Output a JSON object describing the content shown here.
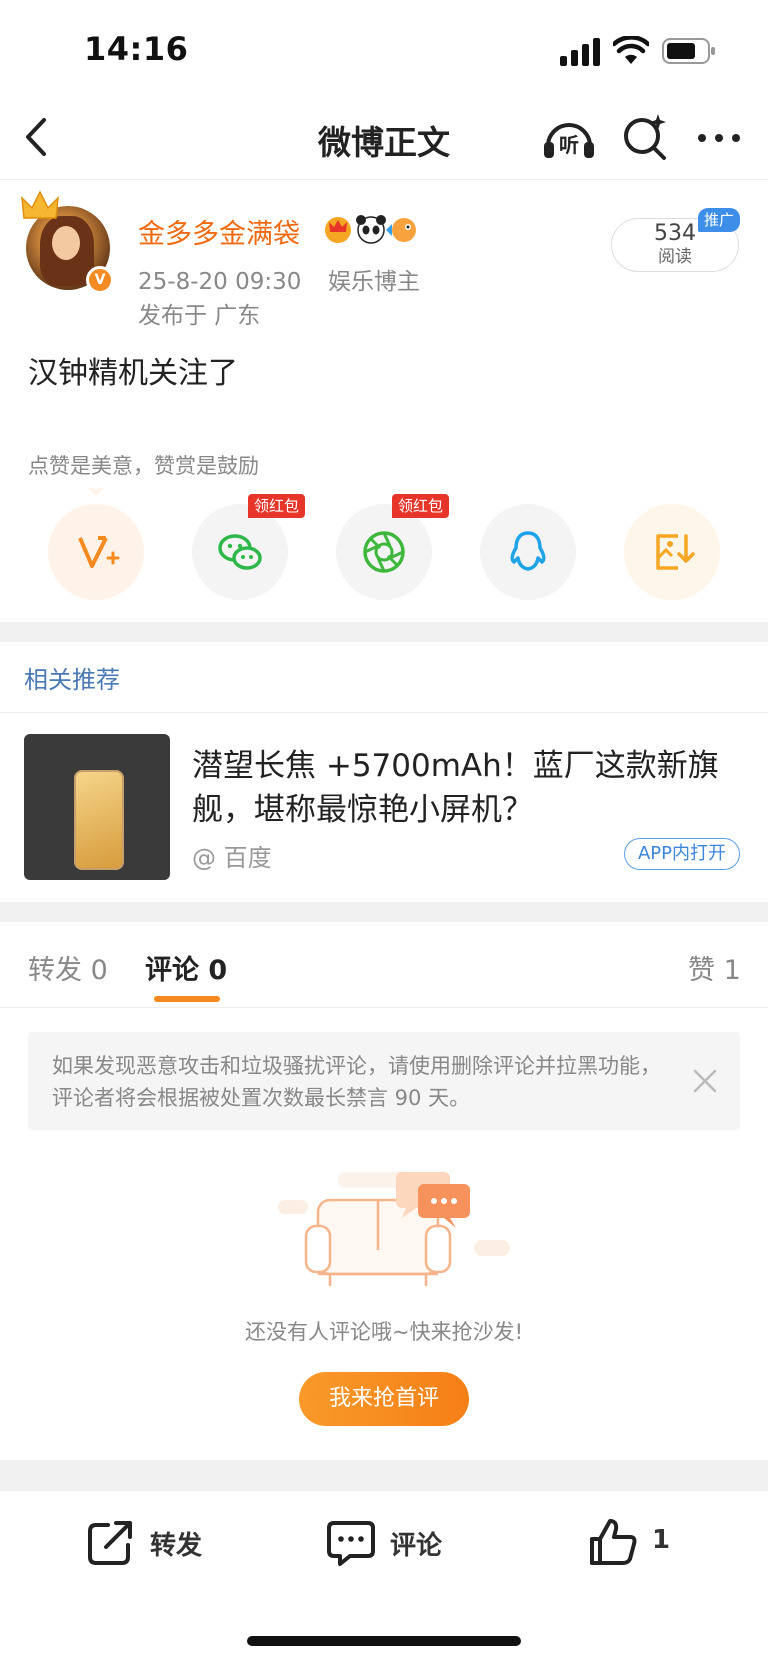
{
  "status_bar": {
    "time": "14:16"
  },
  "nav": {
    "title": "微博正文",
    "listen_icon": "headphones-listen-icon",
    "listen_label": "听",
    "search_icon": "search-sparkle-icon",
    "more_icon": "more-dots-icon"
  },
  "post": {
    "username": "金多多金满袋",
    "username_color": "#f26a10",
    "date_time": "25-8-20 09:30",
    "user_tag": "娱乐博主",
    "location": "发布于 广东",
    "reads_count": "534",
    "reads_label": "阅读",
    "promo_label": "推广",
    "content": "汉钟精机关注了",
    "verified_mark": "V"
  },
  "reward": {
    "tip": "点赞是美意，赞赏是鼓励",
    "share_buttons": [
      {
        "icon": "reward-v-icon"
      },
      {
        "icon": "wechat-icon",
        "badge": "领红包"
      },
      {
        "icon": "moments-icon",
        "badge": "领红包"
      },
      {
        "icon": "qq-icon"
      },
      {
        "icon": "save-image-icon"
      }
    ]
  },
  "related": {
    "section_title": "相关推荐",
    "headline": "潜望长焦 +5700mAh！蓝厂这款新旗舰，堪称最惊艳小屏机？",
    "source": "@ 百度",
    "open_in_app": "APP内打开"
  },
  "tabs": {
    "forward": "转发 0",
    "comments": "评论 0",
    "likes": "赞 1"
  },
  "notice": {
    "text": "如果发现恶意攻击和垃圾骚扰评论，请使用删除评论并拉黑功能，评论者将会根据被处置次数最长禁言 90 天。"
  },
  "empty_state": {
    "text": "还没有人评论哦~快来抢沙发!",
    "button": "我来抢首评"
  },
  "bottom_bar": {
    "forward": "转发",
    "comment": "评论",
    "like_count": "1"
  },
  "colors": {
    "accent": "#f78a1f",
    "link_blue": "#4a79b3",
    "red_badge": "#e8352a"
  }
}
